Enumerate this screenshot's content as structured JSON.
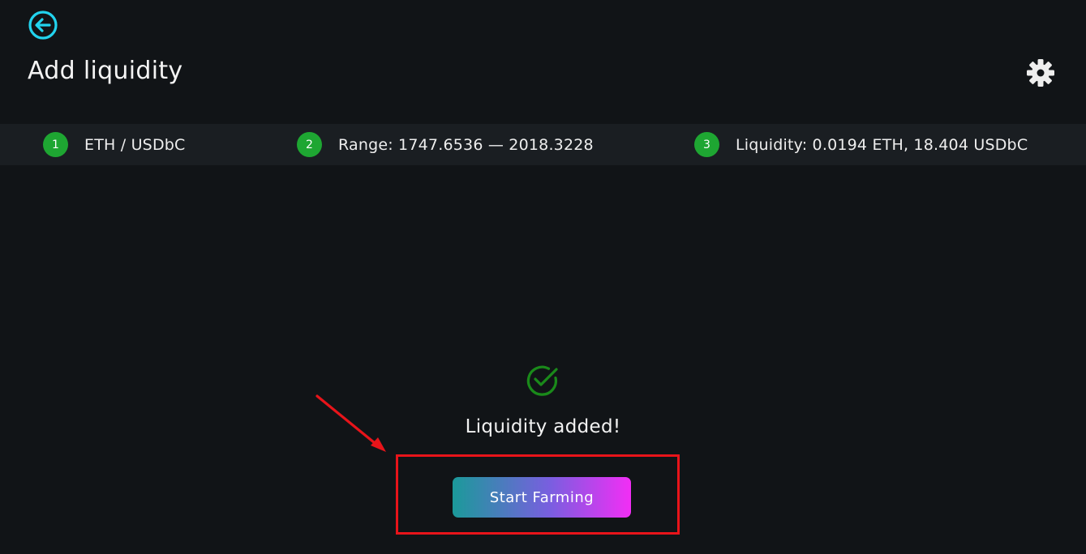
{
  "header": {
    "title": "Add liquidity",
    "back_icon": "arrow-left-circle-icon",
    "settings_icon": "gear-icon"
  },
  "steps": [
    {
      "number": "1",
      "label": "ETH / USDbC"
    },
    {
      "number": "2",
      "label": "Range: 1747.6536 — 2018.3228"
    },
    {
      "number": "3",
      "label": "Liquidity: 0.0194 ETH, 18.404 USDbC"
    }
  ],
  "result": {
    "icon": "check-circle-icon",
    "message": "Liquidity added!",
    "button_label": "Start Farming"
  },
  "colors": {
    "accent": "#22d3ee",
    "step_badge": "#1ea632",
    "success": "#1a8a1a",
    "button_gradient_start": "#1b9a9a",
    "button_gradient_end": "#f22ef5",
    "annotation": "#e8141a"
  }
}
